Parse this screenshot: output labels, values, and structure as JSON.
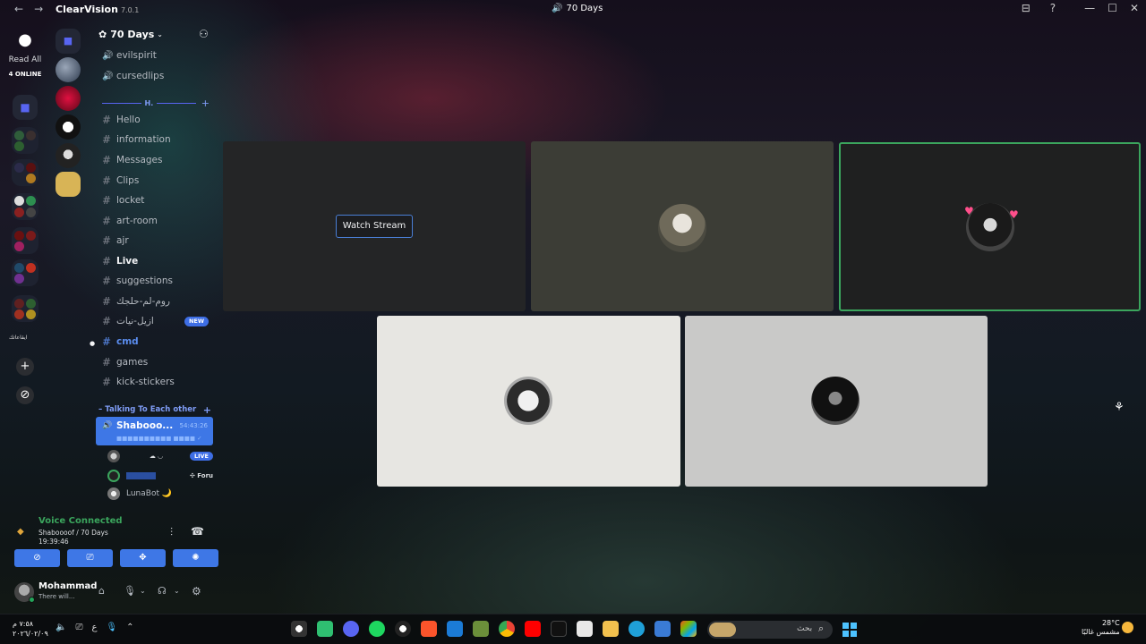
{
  "titlebar": {
    "back": "←",
    "forward": "→",
    "app_name": "ClearVision",
    "version": "7.0.1",
    "window_title": "70 Days",
    "minimize": "—",
    "maximize": "☐",
    "close": "✕",
    "inbox_icon": "⊟",
    "help_icon": "?"
  },
  "rail": {
    "read_all": "Read All",
    "online": "4 ONLINE",
    "server_label": "ايقاعاتك",
    "add": "+",
    "explore": "⊘"
  },
  "server": {
    "name": "70 Days",
    "chevron": "⌄",
    "invite_icon": "⚇"
  },
  "voice_channels_top": [
    {
      "label": "evilspirit"
    },
    {
      "label": "cursedlips"
    }
  ],
  "category": {
    "label": "H."
  },
  "text_channels": [
    {
      "label": "Hello",
      "bold": false
    },
    {
      "label": "information",
      "bold": false
    },
    {
      "label": "Messages",
      "bold": false
    },
    {
      "label": "Clips",
      "bold": false
    },
    {
      "label": "locket",
      "bold": false
    },
    {
      "label": "art-room",
      "bold": false
    },
    {
      "label": "ajr",
      "bold": false
    },
    {
      "label": "Live",
      "bold": true
    },
    {
      "label": "suggestions",
      "bold": false
    },
    {
      "label": "روم-لم-حلجك",
      "bold": false
    },
    {
      "label": "ازيل-نيات",
      "bold": false
    },
    {
      "label": "cmd",
      "bold": false
    },
    {
      "label": "games",
      "bold": false
    },
    {
      "label": "kick-stickers",
      "bold": false
    }
  ],
  "new_badge": "NEW",
  "voice_category": {
    "label": "Talking To Each other"
  },
  "active_voice": {
    "name": "Shabooo...",
    "time": "54:43:26",
    "sub": "■■■■■■■■■■ ■■■■ ✓"
  },
  "voice_users": [
    {
      "name": "",
      "extra": "☁ ◡",
      "badge": "LIVE"
    },
    {
      "name": "■■■■■",
      "extra": "✣ Foru",
      "badge": ""
    },
    {
      "name": "LunaBot 🌙",
      "extra": "",
      "badge": ""
    }
  ],
  "voice_panel": {
    "title": "Voice Connected",
    "path": "Shaboooof / 70 Days",
    "time": "19:39:46"
  },
  "voice_buttons": [
    {
      "name": "camera-off-icon",
      "glyph": "⊘"
    },
    {
      "name": "screen-share-icon",
      "glyph": "⎚"
    },
    {
      "name": "activities-icon",
      "glyph": "✥"
    },
    {
      "name": "soundboard-icon",
      "glyph": "✺"
    }
  ],
  "user": {
    "name": "Mohammad",
    "status": "There will...",
    "controller": "⌂",
    "mic": "🎙",
    "headset": "☊",
    "settings": "⚙",
    "caret": "⌄"
  },
  "stage": {
    "watch_stream": "Watch Stream"
  },
  "taskbar": {
    "time": "٧:٥٨ م",
    "date": "٢٠٢٦/٠٢/٠٩",
    "lang": "ع",
    "search_label": "بحث",
    "temp": "28°C",
    "weather": "مشمس غالبًا"
  },
  "colors": {
    "accent": "#3e77e6",
    "voice_green": "#3ba55d",
    "speaking_border": "#3ba55d",
    "live_badge": "#3e6ee5"
  }
}
